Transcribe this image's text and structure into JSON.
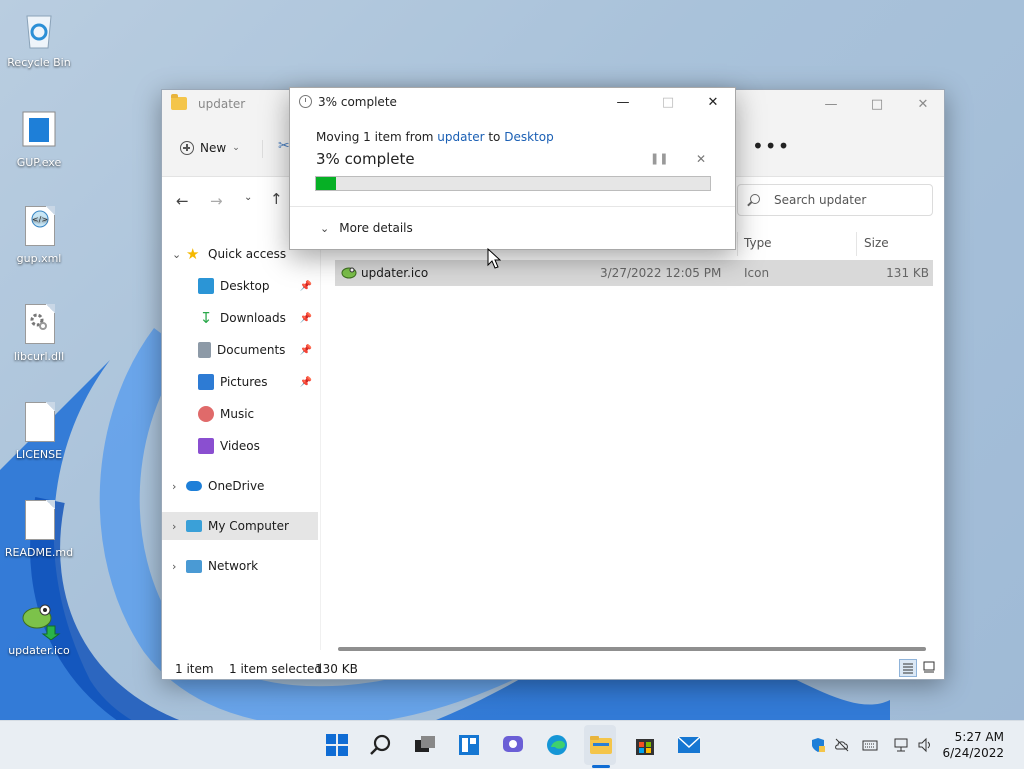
{
  "desktop": {
    "icons": [
      {
        "label": "Recycle Bin"
      },
      {
        "label": "GUP.exe"
      },
      {
        "label": "gup.xml"
      },
      {
        "label": "libcurl.dll"
      },
      {
        "label": "LICENSE"
      },
      {
        "label": "README.md"
      },
      {
        "label": "updater.ico"
      }
    ]
  },
  "explorer": {
    "title": "updater",
    "toolbar": {
      "new_label": "New",
      "more": "•••"
    },
    "search_placeholder": "Search updater",
    "nav": {
      "quick_access": "Quick access",
      "items": [
        {
          "label": "Desktop"
        },
        {
          "label": "Downloads"
        },
        {
          "label": "Documents"
        },
        {
          "label": "Pictures"
        },
        {
          "label": "Music"
        },
        {
          "label": "Videos"
        }
      ],
      "onedrive": "OneDrive",
      "my_computer": "My Computer",
      "network": "Network"
    },
    "columns": {
      "type": "Type",
      "size": "Size"
    },
    "files": [
      {
        "name": "updater.ico",
        "date": "3/27/2022 12:05 PM",
        "type": "Icon",
        "size": "131 KB"
      }
    ],
    "status": {
      "count": "1 item",
      "selected": "1 item selected",
      "size": "130 KB"
    }
  },
  "dialog": {
    "title": "3% complete",
    "moving_prefix": "Moving 1 item from ",
    "source": "updater",
    "to_word": " to ",
    "destination": "Desktop",
    "status": "3% complete",
    "progress": 0.05,
    "details_label": "More details"
  },
  "taskbar": {
    "time": "5:27 AM",
    "date": "6/24/2022"
  },
  "colors": {
    "progress": "#06b025",
    "link": "#1a5fb4",
    "accent": "#0067c0"
  }
}
